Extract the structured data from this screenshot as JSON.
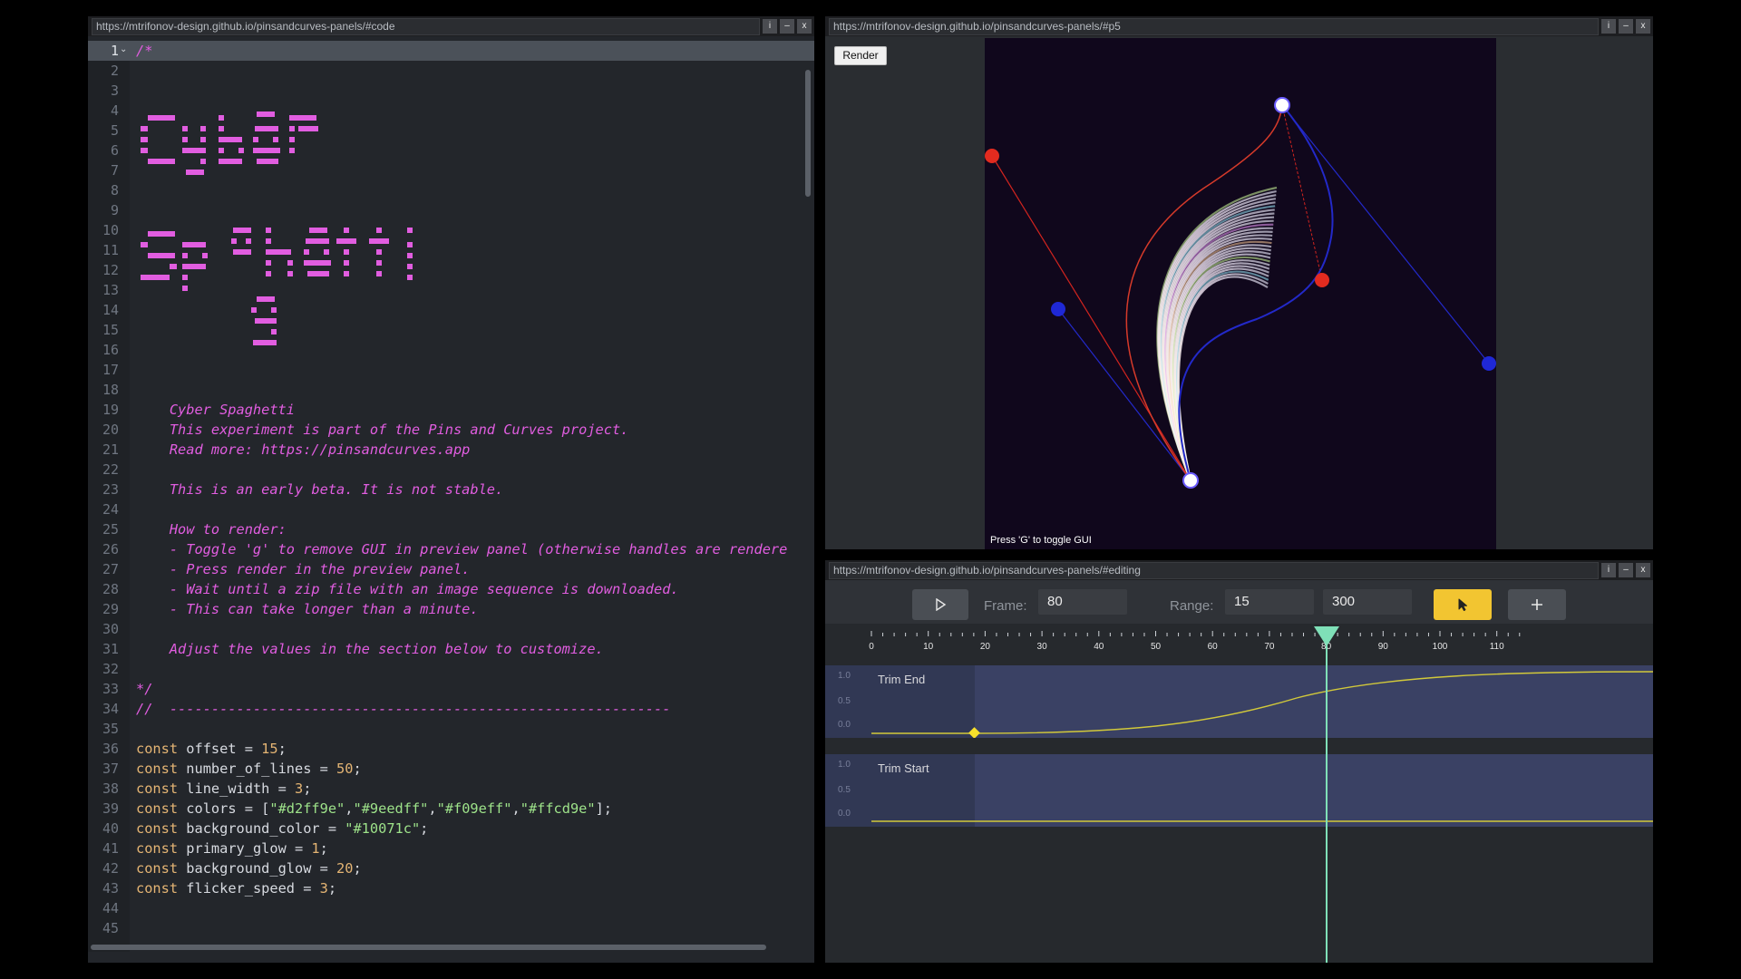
{
  "code_panel": {
    "url": "https://mtrifonov-design.github.io/pinsandcurves-panels/#code",
    "window_buttons": [
      "i",
      "–",
      "x"
    ],
    "ascii_title_lines": [
      "Cyber",
      "Spaghetti"
    ],
    "lines": [
      {
        "n": "1",
        "parts": [
          [
            "cmt",
            "/*"
          ]
        ],
        "active": true
      },
      {
        "n": "2",
        "parts": []
      },
      {
        "n": "3",
        "parts": []
      },
      {
        "n": "4",
        "parts": []
      },
      {
        "n": "5",
        "parts": []
      },
      {
        "n": "6",
        "parts": []
      },
      {
        "n": "7",
        "parts": []
      },
      {
        "n": "8",
        "parts": []
      },
      {
        "n": "9",
        "parts": []
      },
      {
        "n": "10",
        "parts": []
      },
      {
        "n": "11",
        "parts": []
      },
      {
        "n": "12",
        "parts": []
      },
      {
        "n": "13",
        "parts": []
      },
      {
        "n": "14",
        "parts": []
      },
      {
        "n": "15",
        "parts": []
      },
      {
        "n": "16",
        "parts": []
      },
      {
        "n": "17",
        "parts": []
      },
      {
        "n": "18",
        "parts": []
      },
      {
        "n": "19",
        "parts": [
          [
            "cmt",
            "    Cyber Spaghetti"
          ]
        ]
      },
      {
        "n": "20",
        "parts": [
          [
            "cmt",
            "    This experiment is part of the Pins and Curves project."
          ]
        ]
      },
      {
        "n": "21",
        "parts": [
          [
            "cmt",
            "    Read more: https://pinsandcurves.app"
          ]
        ]
      },
      {
        "n": "22",
        "parts": []
      },
      {
        "n": "23",
        "parts": [
          [
            "cmt",
            "    This is an early beta. It is not stable."
          ]
        ]
      },
      {
        "n": "24",
        "parts": []
      },
      {
        "n": "25",
        "parts": [
          [
            "cmt",
            "    How to render:"
          ]
        ]
      },
      {
        "n": "26",
        "parts": [
          [
            "cmt",
            "    - Toggle 'g' to remove GUI in preview panel (otherwise handles are rendere"
          ]
        ]
      },
      {
        "n": "27",
        "parts": [
          [
            "cmt",
            "    - Press render in the preview panel."
          ]
        ]
      },
      {
        "n": "28",
        "parts": [
          [
            "cmt",
            "    - Wait until a zip file with an image sequence is downloaded."
          ]
        ]
      },
      {
        "n": "29",
        "parts": [
          [
            "cmt",
            "    - This can take longer than a minute."
          ]
        ]
      },
      {
        "n": "30",
        "parts": []
      },
      {
        "n": "31",
        "parts": [
          [
            "cmt",
            "    Adjust the values in the section below to customize."
          ]
        ]
      },
      {
        "n": "32",
        "parts": []
      },
      {
        "n": "33",
        "parts": [
          [
            "cmt",
            "*/"
          ]
        ]
      },
      {
        "n": "34",
        "parts": [
          [
            "cmt",
            "//  ------------------------------------------------------------"
          ]
        ]
      },
      {
        "n": "35",
        "parts": []
      },
      {
        "n": "36",
        "parts": [
          [
            "kw",
            "const"
          ],
          [
            "pl",
            " offset = "
          ],
          [
            "num",
            "15"
          ],
          [
            "pl",
            ";"
          ]
        ]
      },
      {
        "n": "37",
        "parts": [
          [
            "kw",
            "const"
          ],
          [
            "pl",
            " number_of_lines = "
          ],
          [
            "num",
            "50"
          ],
          [
            "pl",
            ";"
          ]
        ]
      },
      {
        "n": "38",
        "parts": [
          [
            "kw",
            "const"
          ],
          [
            "pl",
            " line_width = "
          ],
          [
            "num",
            "3"
          ],
          [
            "pl",
            ";"
          ]
        ]
      },
      {
        "n": "39",
        "parts": [
          [
            "kw",
            "const"
          ],
          [
            "pl",
            " colors = ["
          ],
          [
            "str",
            "\"#d2ff9e\""
          ],
          [
            "pl",
            ","
          ],
          [
            "str",
            "\"#9eedff\""
          ],
          [
            "pl",
            ","
          ],
          [
            "str",
            "\"#f09eff\""
          ],
          [
            "pl",
            ","
          ],
          [
            "str",
            "\"#ffcd9e\""
          ],
          [
            "pl",
            "];"
          ]
        ]
      },
      {
        "n": "40",
        "parts": [
          [
            "kw",
            "const"
          ],
          [
            "pl",
            " background_color = "
          ],
          [
            "str",
            "\"#10071c\""
          ],
          [
            "pl",
            ";"
          ]
        ]
      },
      {
        "n": "41",
        "parts": [
          [
            "kw",
            "const"
          ],
          [
            "pl",
            " primary_glow = "
          ],
          [
            "num",
            "1"
          ],
          [
            "pl",
            ";"
          ]
        ]
      },
      {
        "n": "42",
        "parts": [
          [
            "kw",
            "const"
          ],
          [
            "pl",
            " background_glow = "
          ],
          [
            "num",
            "20"
          ],
          [
            "pl",
            ";"
          ]
        ]
      },
      {
        "n": "43",
        "parts": [
          [
            "kw",
            "const"
          ],
          [
            "pl",
            " flicker_speed = "
          ],
          [
            "num",
            "3"
          ],
          [
            "pl",
            ";"
          ]
        ]
      },
      {
        "n": "44",
        "parts": []
      },
      {
        "n": "45",
        "parts": []
      }
    ]
  },
  "preview_panel": {
    "url": "https://mtrifonov-design.github.io/pinsandcurves-panels/#p5",
    "window_buttons": [
      "i",
      "–",
      "x"
    ],
    "render_label": "Render",
    "hint": "Press 'G' to toggle GUI",
    "background_color": "#10071c",
    "line_colors": [
      "#d2ff9e",
      "#9eedff",
      "#f09eff",
      "#ffcd9e"
    ]
  },
  "timeline_panel": {
    "url": "https://mtrifonov-design.github.io/pinsandcurves-panels/#editing",
    "window_buttons": [
      "i",
      "–",
      "x"
    ],
    "play_icon": "play-icon",
    "frame_label": "Frame:",
    "frame_value": "80",
    "range_label": "Range:",
    "range_start": "15",
    "range_end": "300",
    "select_icon": "cursor-icon",
    "add_icon": "plus-icon",
    "accent_color": "#f2c531",
    "ruler_ticks": [
      "0",
      "10",
      "20",
      "30",
      "40",
      "50",
      "60",
      "70",
      "80",
      "90",
      "100",
      "110"
    ],
    "playhead_frame": 80,
    "tracks": [
      {
        "name": "Trim End",
        "axis": [
          "1.0",
          "0.5",
          "0.0"
        ],
        "keyframe_frame": 15
      },
      {
        "name": "Trim Start",
        "axis": [
          "1.0",
          "0.5",
          "0.0"
        ]
      }
    ]
  }
}
